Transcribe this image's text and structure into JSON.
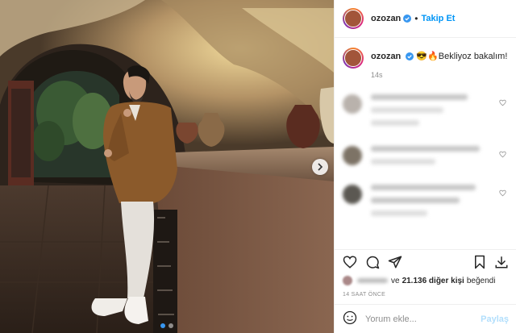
{
  "post": {
    "username": "ozozan",
    "follow_label": "Takip Et",
    "separator": "•",
    "caption_text": "😎🔥Bekliyoz bakalım!",
    "caption_time": "14s",
    "likes_prefix_hidden": true,
    "likes_and": "ve",
    "likes_count": "21.136 diğer kişi",
    "likes_suffix": "beğendi",
    "time_ago": "14 SAAT ÖNCE",
    "comment_placeholder": "Yorum ekle...",
    "post_label": "Paylaş",
    "carousel": {
      "slides": 2,
      "active_index": 0
    }
  },
  "colors": {
    "accent": "#0095f6",
    "post_disabled": "#b2dffc",
    "meta": "#8e8e8e",
    "carousel_active": "#3897f0"
  },
  "icons": {
    "verified": "verified-badge-icon",
    "like": "heart-icon",
    "comment": "comment-icon",
    "share": "share-icon",
    "save": "bookmark-icon",
    "download": "download-icon",
    "emoji": "emoji-icon",
    "next": "chevron-right-icon"
  }
}
